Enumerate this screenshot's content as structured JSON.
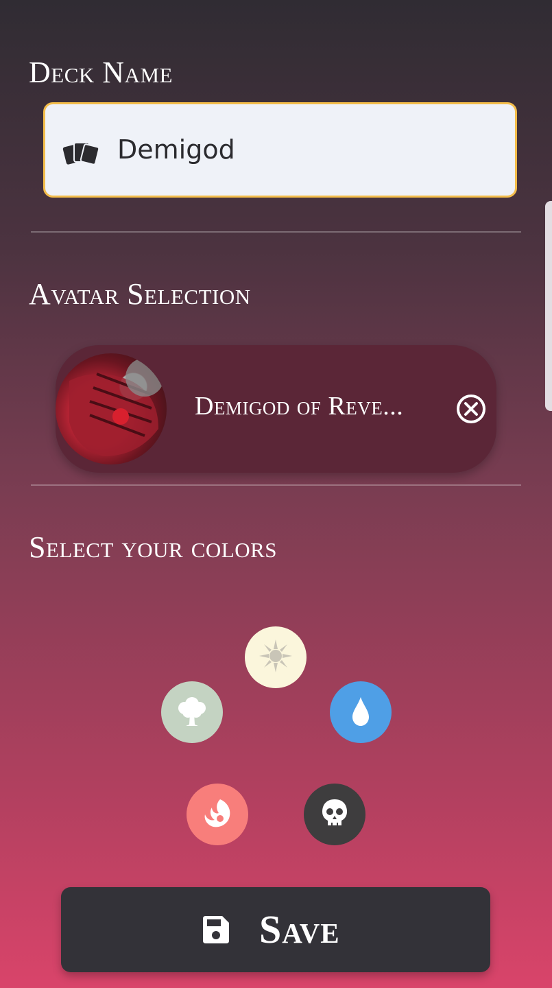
{
  "deck_name": {
    "title": "Deck Name",
    "value": "Demigod",
    "icon": "cards-icon",
    "border_color": "#f3bd4b"
  },
  "avatar": {
    "title": "Avatar Selection",
    "card_name": "Demigod of Reve...",
    "remove_icon": "close-circle-icon"
  },
  "colors": {
    "title": "Select your colors",
    "options": [
      {
        "name": "white",
        "icon": "sun-icon",
        "color": "#fbf6dc"
      },
      {
        "name": "green",
        "icon": "tree-icon",
        "color": "#c4d3c2"
      },
      {
        "name": "blue",
        "icon": "water-drop-icon",
        "color": "#4f9fe6"
      },
      {
        "name": "red",
        "icon": "fire-icon",
        "color": "#f87e7b"
      },
      {
        "name": "black",
        "icon": "skull-icon",
        "color": "#3e3d3e"
      }
    ]
  },
  "save_button": {
    "label": "Save",
    "icon": "floppy-disk-icon"
  }
}
